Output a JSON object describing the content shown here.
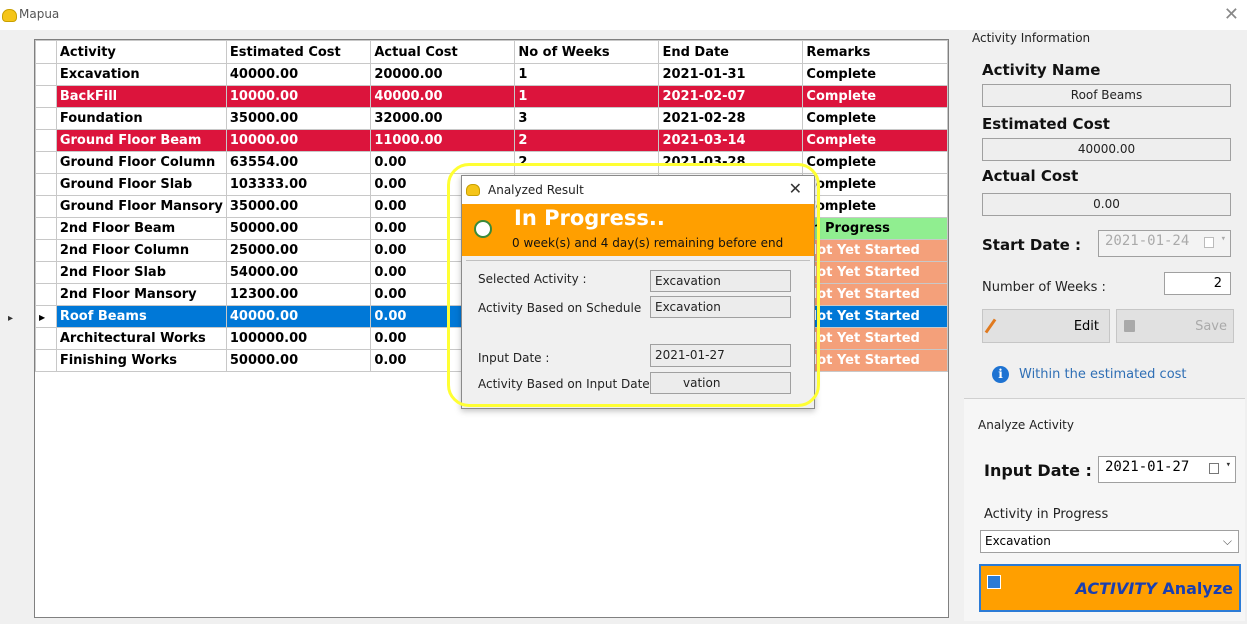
{
  "window": {
    "title": "Mapua"
  },
  "grid": {
    "columns": [
      "Activity",
      "Estimated Cost",
      "Actual Cost",
      "No of Weeks",
      "End Date",
      "Remarks"
    ],
    "rows": [
      {
        "activity": "Excavation",
        "est": "40000.00",
        "act": "20000.00",
        "weeks": "1",
        "end": "2021-01-31",
        "remarks": "Complete",
        "style": "plain",
        "remark_style": "plain"
      },
      {
        "activity": "BackFill",
        "est": "10000.00",
        "act": "40000.00",
        "weeks": "1",
        "end": "2021-02-07",
        "remarks": "Complete",
        "style": "red",
        "remark_style": "plain"
      },
      {
        "activity": "Foundation",
        "est": "35000.00",
        "act": "32000.00",
        "weeks": "3",
        "end": "2021-02-28",
        "remarks": "Complete",
        "style": "plain",
        "remark_style": "plain"
      },
      {
        "activity": "Ground Floor Beam",
        "est": "10000.00",
        "act": "11000.00",
        "weeks": "2",
        "end": "2021-03-14",
        "remarks": "Complete",
        "style": "red",
        "remark_style": "plain"
      },
      {
        "activity": "Ground Floor Column",
        "est": "63554.00",
        "act": "0.00",
        "weeks": "2",
        "end": "2021-03-28",
        "remarks": "Complete",
        "style": "plain",
        "remark_style": "plain"
      },
      {
        "activity": "Ground Floor Slab",
        "est": "103333.00",
        "act": "0.00",
        "weeks": "",
        "end": "",
        "remarks": "Complete",
        "style": "plain",
        "remark_style": "plain"
      },
      {
        "activity": "Ground Floor Mansory",
        "est": "35000.00",
        "act": "0.00",
        "weeks": "",
        "end": "",
        "remarks": "Complete",
        "style": "plain",
        "remark_style": "plain"
      },
      {
        "activity": "2nd Floor Beam",
        "est": "50000.00",
        "act": "0.00",
        "weeks": "",
        "end": "",
        "remarks": "In Progress",
        "style": "plain",
        "remark_style": "green"
      },
      {
        "activity": "2nd Floor Column",
        "est": "25000.00",
        "act": "0.00",
        "weeks": "",
        "end": "",
        "remarks": "Not Yet Started",
        "style": "plain",
        "remark_style": "salmon"
      },
      {
        "activity": "2nd Floor Slab",
        "est": "54000.00",
        "act": "0.00",
        "weeks": "",
        "end": "",
        "remarks": "Not Yet Started",
        "style": "plain",
        "remark_style": "salmon"
      },
      {
        "activity": "2nd Floor Mansory",
        "est": "12300.00",
        "act": "0.00",
        "weeks": "",
        "end": "",
        "remarks": "Not Yet Started",
        "style": "plain",
        "remark_style": "salmon"
      },
      {
        "activity": "Roof Beams",
        "est": "40000.00",
        "act": "0.00",
        "weeks": "",
        "end": "",
        "remarks": "Not Yet Started",
        "style": "blue",
        "remark_style": "blue",
        "selected": true
      },
      {
        "activity": "Architectural Works",
        "est": "100000.00",
        "act": "0.00",
        "weeks": "",
        "end": "",
        "remarks": "Not Yet Started",
        "style": "plain",
        "remark_style": "salmon"
      },
      {
        "activity": "Finishing Works",
        "est": "50000.00",
        "act": "0.00",
        "weeks": "",
        "end": "",
        "remarks": "Not Yet Started",
        "style": "plain",
        "remark_style": "salmon"
      }
    ]
  },
  "activity_info": {
    "group_title": "Activity Information",
    "name_label": "Activity Name",
    "name_value": "Roof Beams",
    "est_label": "Estimated Cost",
    "est_value": "40000.00",
    "act_label": "Actual Cost",
    "act_value": "0.00",
    "start_label": "Start Date :",
    "start_value": "2021-01-24",
    "weeks_label": "Number of Weeks :",
    "weeks_value": "2",
    "edit_label": "Edit",
    "save_label": "Save",
    "status_text": "Within the estimated cost"
  },
  "analyze": {
    "group_title": "Analyze Activity",
    "input_label": "Input Date :",
    "input_value": "2021-01-27",
    "progress_label": "Activity in Progress",
    "progress_value": "Excavation",
    "button_part1": "ACTIVITY",
    "button_part2": " Analyze"
  },
  "dialog": {
    "title": "Analyzed Result",
    "status": "In Progress..",
    "remaining": "0 week(s) and 4 day(s) remaining before end",
    "selected_label": "Selected Activity :",
    "selected_value": "Excavation",
    "schedule_label": "Activity Based on Schedule",
    "schedule_value": "Excavation",
    "input_label": "Input Date :",
    "input_value": "2021-01-27",
    "input_activity_label": "Activity Based on Input Date :",
    "input_activity_value": "vation"
  },
  "colors": {
    "red_row": "#dc143c",
    "blue_row": "#0078d7",
    "in_progress": "#90ee90",
    "not_started": "#f4a07a",
    "banner": "#ff9f00",
    "highlight": "#ffff33"
  }
}
